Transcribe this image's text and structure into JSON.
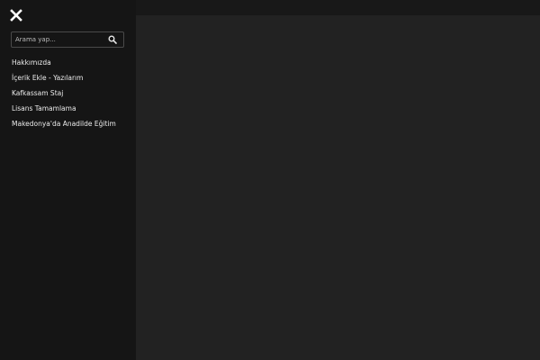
{
  "header": {
    "close_icon": "close-icon"
  },
  "search": {
    "placeholder": "Arama yap...",
    "value": "",
    "icon": "search-icon"
  },
  "nav": {
    "items": [
      {
        "label": "Hakkımızda"
      },
      {
        "label": "İçerik Ekle - Yazılarım"
      },
      {
        "label": "Kafkassam Staj"
      },
      {
        "label": "Lisans Tamamlama"
      },
      {
        "label": "Makedonya'da Anadilde Eğitim"
      }
    ]
  },
  "colors": {
    "sidebar_bg": "#151515",
    "content_bg": "#222222",
    "text": "#ececec"
  }
}
